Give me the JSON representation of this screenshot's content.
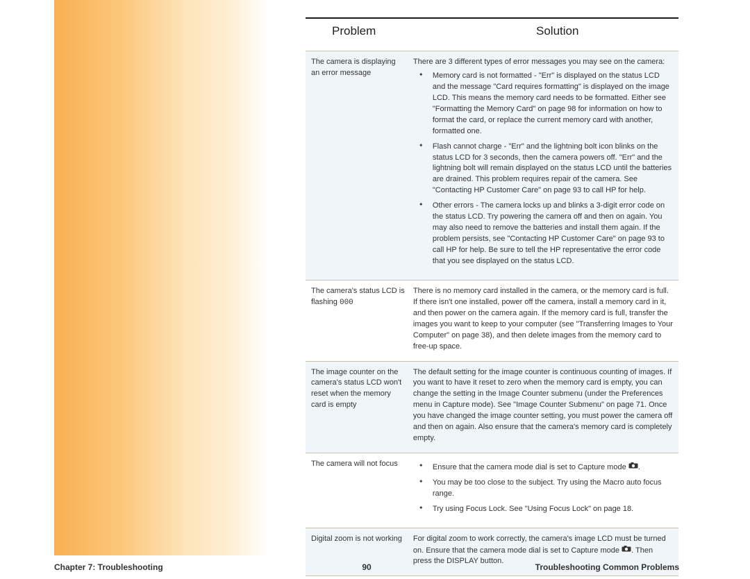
{
  "header": {
    "problem": "Problem",
    "solution": "Solution"
  },
  "rows": [
    {
      "problem": "The camera is displaying an error message",
      "solution_lead": "There are 3 different types of error messages you may see on the camera:",
      "bullets": [
        "Memory card is not formatted - \"Err\" is displayed on the status LCD and the message \"Card requires formatting\" is displayed on the image LCD. This means the memory card needs to be formatted. Either see \"Formatting the Memory Card\" on page 98 for information on how to format the card, or replace the current memory card with another, formatted one.",
        "Flash cannot charge - \"Err\" and the lightning bolt icon blinks on the status LCD for 3 seconds, then the camera powers off. \"Err\" and the lightning bolt will remain displayed on the status LCD until the batteries are drained. This problem requires repair of the camera. See \"Contacting HP Customer Care\" on page 93 to call HP for help.",
        "Other errors - The camera locks up and blinks a 3-digit error code on the status LCD. Try powering the camera off and then on again. You may also need to remove the batteries and install them again. If the problem persists, see \"Contacting HP Customer Care\" on page 93 to call HP for help. Be sure to tell the HP representative the error code that you see displayed on the status LCD."
      ]
    },
    {
      "problem_pre": "The camera's status LCD is flashing ",
      "problem_code": "000",
      "solution_text": "There is no memory card installed in the camera, or the memory card is full. If there isn't one installed, power off the camera, install a memory card in it, and then power on the camera again. If the memory card is full, transfer the images you want to keep to your computer (see \"Transferring Images to Your Computer\" on page 38), and then delete images from the memory card to free-up space."
    },
    {
      "problem": "The image counter on the camera's status LCD won't reset when the memory card is empty",
      "solution_text": "The default setting for the image counter is continuous counting of images. If you want to have it reset to zero when the memory card is empty, you can change the setting in the Image Counter submenu (under the Preferences menu in Capture mode). See \"Image Counter Submenu\" on page 71. Once you have changed the image counter setting, you must power the camera off and then on again. Also ensure that the camera's memory card is completely empty."
    },
    {
      "problem": "The camera will not focus",
      "bullets_cam": [
        {
          "pre": "Ensure that the camera mode dial is set to Capture mode ",
          "post": "."
        },
        {
          "text": "You may be too close to the subject. Try using the Macro auto focus range."
        },
        {
          "text": "Try using Focus Lock. See \"Using Focus Lock\" on page 18."
        }
      ]
    },
    {
      "problem": "Digital zoom is not working",
      "solution_pre": "For digital zoom to work correctly, the camera's image LCD must be turned on. Ensure that the camera mode dial is set to Capture mode ",
      "solution_post": ". Then press the DISPLAY button."
    }
  ],
  "footer": {
    "left": "Chapter 7: Troubleshooting",
    "center": "90",
    "right": "Troubleshooting Common Problems"
  }
}
